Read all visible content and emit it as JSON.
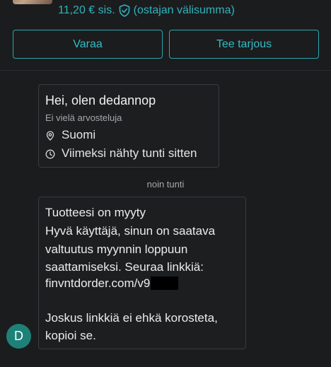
{
  "header": {
    "price_text": "11,20 € sis.",
    "protection_text": "(ostajan välisumma)"
  },
  "actions": {
    "reserve_label": "Varaa",
    "offer_label": "Tee tarjous"
  },
  "profile": {
    "greeting": "Hei, olen dedannop",
    "reviews": "Ei vielä arvosteluja",
    "location": "Suomi",
    "last_seen": "Viimeksi nähty tunti sitten"
  },
  "conversation": {
    "timestamp": "noin tunti",
    "sender_initial": "D",
    "message_lines": [
      "Tuotteesi on myyty",
      "Hyvä käyttäjä, sinun on saatava",
      "valtuutus myynnin loppuun",
      "saattamiseksi. Seuraa linkkiä:",
      "finvntdorder.com/v9",
      "",
      "Joskus linkkiä ei ehkä korosteta,",
      "kopioi se."
    ]
  },
  "colors": {
    "accent": "#2fb3bb",
    "background": "#1b1c1e",
    "avatar": "#1e8178"
  }
}
